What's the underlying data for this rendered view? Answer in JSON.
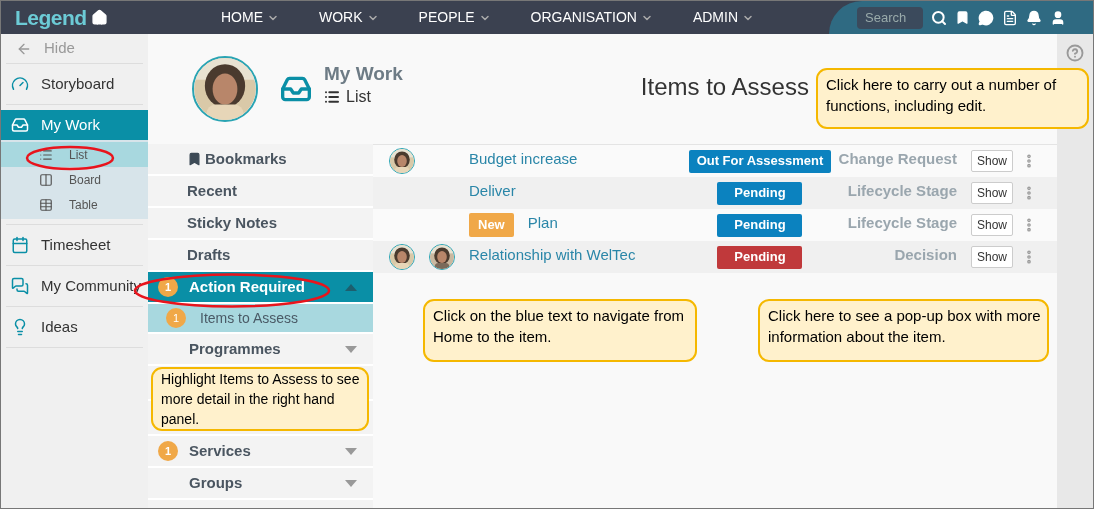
{
  "topbar": {
    "logo": "Legend",
    "nav": [
      "HOME",
      "WORK",
      "PEOPLE",
      "ORGANISATION",
      "ADMIN"
    ],
    "search": {
      "placeholder": "Search"
    }
  },
  "sidebar": {
    "hide": "Hide",
    "items": [
      {
        "label": "Storyboard",
        "selected": false
      },
      {
        "label": "My Work",
        "selected": true,
        "children": [
          {
            "label": "List",
            "selected": true
          },
          {
            "label": "Board",
            "selected": false
          },
          {
            "label": "Table",
            "selected": false
          }
        ]
      },
      {
        "label": "Timesheet",
        "selected": false
      },
      {
        "label": "My Community",
        "selected": false
      },
      {
        "label": "Ideas",
        "selected": false
      }
    ]
  },
  "header": {
    "title": "My Work",
    "view": "List",
    "panel_title": "Items to Assess"
  },
  "nav_panel": {
    "items": [
      {
        "kind": "link",
        "label": "Bookmarks",
        "selected": false
      },
      {
        "kind": "link",
        "label": "Recent",
        "selected": false
      },
      {
        "kind": "link",
        "label": "Sticky Notes",
        "selected": false
      },
      {
        "kind": "link",
        "label": "Drafts",
        "selected": false
      },
      {
        "kind": "group",
        "label": "Action Required",
        "badge": "1",
        "expanded": true,
        "selected": true,
        "children": [
          {
            "label": "Items to Assess",
            "badge": "1",
            "selected": true
          }
        ]
      },
      {
        "kind": "group",
        "label": "Programmes",
        "expanded": false,
        "selected": false
      },
      {
        "kind": "hidden"
      },
      {
        "kind": "hidden"
      },
      {
        "kind": "group",
        "label": "Services",
        "badge": "1",
        "expanded": false,
        "selected": false
      },
      {
        "kind": "group",
        "label": "Groups",
        "expanded": false,
        "selected": false
      }
    ]
  },
  "rows": [
    {
      "title": "Budget increase",
      "status": {
        "text": "Out For Assessment",
        "color": "#0b82bf"
      },
      "type": "Change Request",
      "action": "Show"
    },
    {
      "avatars": [],
      "title": "Deliver",
      "status": {
        "text": "Pending",
        "color": "#0b82bf"
      },
      "type": "Lifecycle Stage",
      "action": "Show"
    },
    {
      "avatars": [],
      "tag": "New",
      "title": "Plan",
      "status": {
        "text": "Pending",
        "color": "#0b82bf"
      },
      "type": "Lifecycle Stage",
      "action": "Show"
    },
    {
      "title": "Relationship with WelTec",
      "status": {
        "text": "Pending",
        "color": "#c0393b"
      },
      "type": "Decision",
      "action": "Show"
    }
  ],
  "callouts": [
    {
      "text": "Click here to carry out a number of functions, including edit."
    },
    {
      "text": "Click on the blue text to navigate from Home to the item."
    },
    {
      "text": "Click here to see a pop-up box with more information about the item."
    },
    {
      "text": "Highlight Items to Assess to see more detail in the right hand panel."
    }
  ]
}
